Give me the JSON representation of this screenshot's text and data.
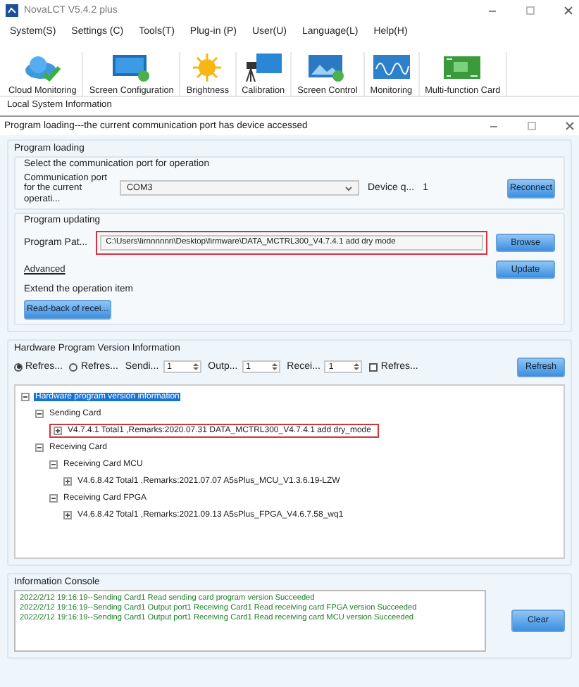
{
  "app": {
    "title": "NovaLCT V5.4.2 plus",
    "menu": [
      "System(S)",
      "Settings (C)",
      "Tools(T)",
      "Plug-in (P)",
      "User(U)",
      "Language(L)",
      "Help(H)"
    ],
    "toolbar": [
      "Cloud Monitoring",
      "Screen Configuration",
      "Brightness",
      "Calibration",
      "Screen Control",
      "Monitoring",
      "Multi-function Card"
    ],
    "local_info": "Local System Information"
  },
  "dialog": {
    "title": "Program loading---the current communication port has device accessed",
    "program_loading": {
      "title": "Program loading",
      "port_group": {
        "title": "Select the communication port for operation",
        "port_label": "Communication port for the current operati...",
        "port_value": "COM3",
        "device_label": "Device q...",
        "device_count": "1",
        "reconnect": "Reconnect"
      },
      "update_group": {
        "title": "Program updating",
        "path_label": "Program Pat...",
        "path_value": "C:\\Users\\lirnnnnnn\\Desktop\\firmware\\DATA_MCTRL300_V4.7.4.1 add dry mode",
        "highlighted": true,
        "browse": "Browse",
        "advanced": "Advanced",
        "update": "Update"
      },
      "extend": {
        "title": "Extend the operation item",
        "read_back": "Read-back of recei..."
      }
    },
    "hardware": {
      "title": "Hardware Program Version Information",
      "options": [
        {
          "label": "Refres...",
          "selected": true
        },
        {
          "label": "Refres...",
          "selected": false
        }
      ],
      "spinners": [
        {
          "label": "Sendi...",
          "value": "1"
        },
        {
          "label": "Outp...",
          "value": "1"
        },
        {
          "label": "Recei...",
          "value": "1"
        }
      ],
      "checkbox": {
        "label": "Refres...",
        "checked": false
      },
      "refresh": "Refresh",
      "tree": {
        "label": "Hardware program version information",
        "selected": true,
        "expanded": true,
        "children": [
          {
            "label": "Sending Card",
            "selected": false,
            "expanded": true,
            "children": [
              {
                "label": "V4.7.4.1 Total1 ,Remarks:2020.07.31 DATA_MCTRL300_V4.7.4.1 add dry_mode",
                "selected": false,
                "expanded": false,
                "highlighted": true
              }
            ]
          },
          {
            "label": "Receiving Card",
            "selected": false,
            "expanded": true,
            "children": [
              {
                "label": "Receiving Card MCU",
                "selected": false,
                "expanded": true,
                "children": [
                  {
                    "label": "V4.6.8.42 Total1 ,Remarks:2021.07.07 A5sPlus_MCU_V1.3.6.19-LZW",
                    "selected": false,
                    "expanded": false
                  }
                ]
              },
              {
                "label": "Receiving Card FPGA",
                "selected": false,
                "expanded": true,
                "children": [
                  {
                    "label": "V4.6.8.42 Total1 ,Remarks:2021.09.13 A5sPlus_FPGA_V4.6.7.58_wq1",
                    "selected": false,
                    "expanded": false
                  }
                ]
              }
            ]
          }
        ]
      }
    },
    "console": {
      "title": "Information Console",
      "lines": [
        "2022/2/12 19:16:19--Sending Card1 Read sending card program version Succeeded",
        "2022/2/12 19:16:19--Sending Card1 Output port1 Receiving Card1 Read receiving card FPGA version Succeeded",
        "2022/2/12 19:16:19--Sending Card1 Output port1 Receiving Card1 Read receiving card MCU version Succeeded"
      ],
      "clear": "Clear"
    }
  }
}
